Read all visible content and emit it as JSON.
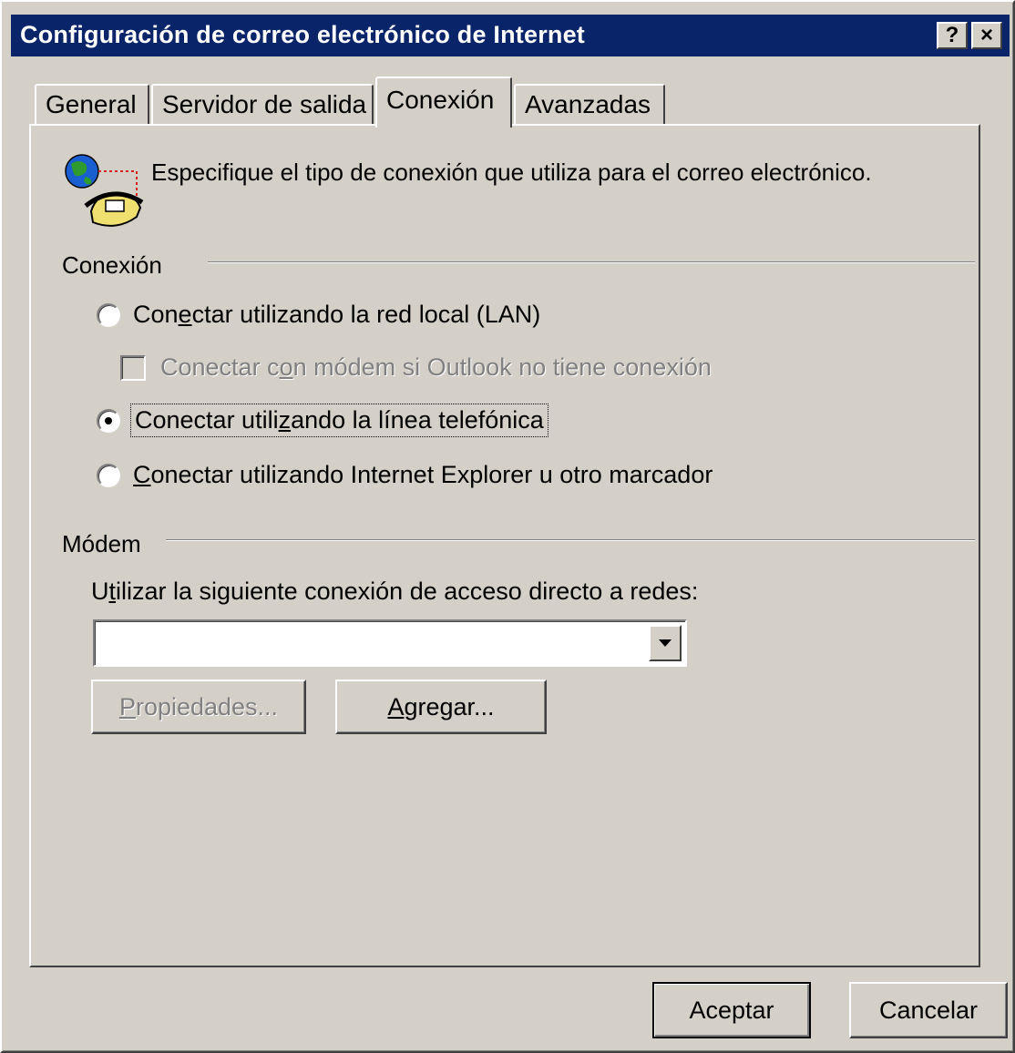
{
  "window": {
    "title": "Configuración de correo electrónico de Internet",
    "help_label": "?",
    "close_label": "×"
  },
  "tabs": [
    {
      "label": "General",
      "active": false
    },
    {
      "label": "Servidor de salida",
      "active": false
    },
    {
      "label": "Conexión",
      "active": true
    },
    {
      "label": "Avanzadas",
      "active": false
    }
  ],
  "intro_text": "Especifique el tipo de conexión que utiliza para el correo electrónico.",
  "connection_group": {
    "label": "Conexión",
    "options": [
      {
        "pre": "Con",
        "key": "e",
        "post": "ctar utilizando la red local (LAN)",
        "checked": false
      },
      {
        "pre": "Conectar utili",
        "key": "z",
        "post": "ando la línea telefónica",
        "checked": true
      },
      {
        "pre": "",
        "key": "C",
        "post": "onectar utilizando Internet Explorer u otro marcador",
        "checked": false
      }
    ],
    "modem_fallback": {
      "pre": "Conectar c",
      "key": "o",
      "post": "n módem si Outlook no tiene conexión",
      "checked": false,
      "disabled": true
    }
  },
  "modem_group": {
    "label": "Módem",
    "prompt_pre": "U",
    "prompt_key": "t",
    "prompt_post": "ilizar la siguiente conexión de acceso directo a redes:",
    "selected_connection": "",
    "properties_key": "P",
    "properties_rest": "ropiedades...",
    "add_key": "A",
    "add_rest": "gregar..."
  },
  "footer": {
    "ok_label": "Aceptar",
    "cancel_label": "Cancelar"
  },
  "colors": {
    "titlebar": "#0a246a",
    "face": "#d4d0c8"
  },
  "icons": {
    "connection": "globe-phone-icon",
    "dropdown": "triangle-down-icon"
  }
}
